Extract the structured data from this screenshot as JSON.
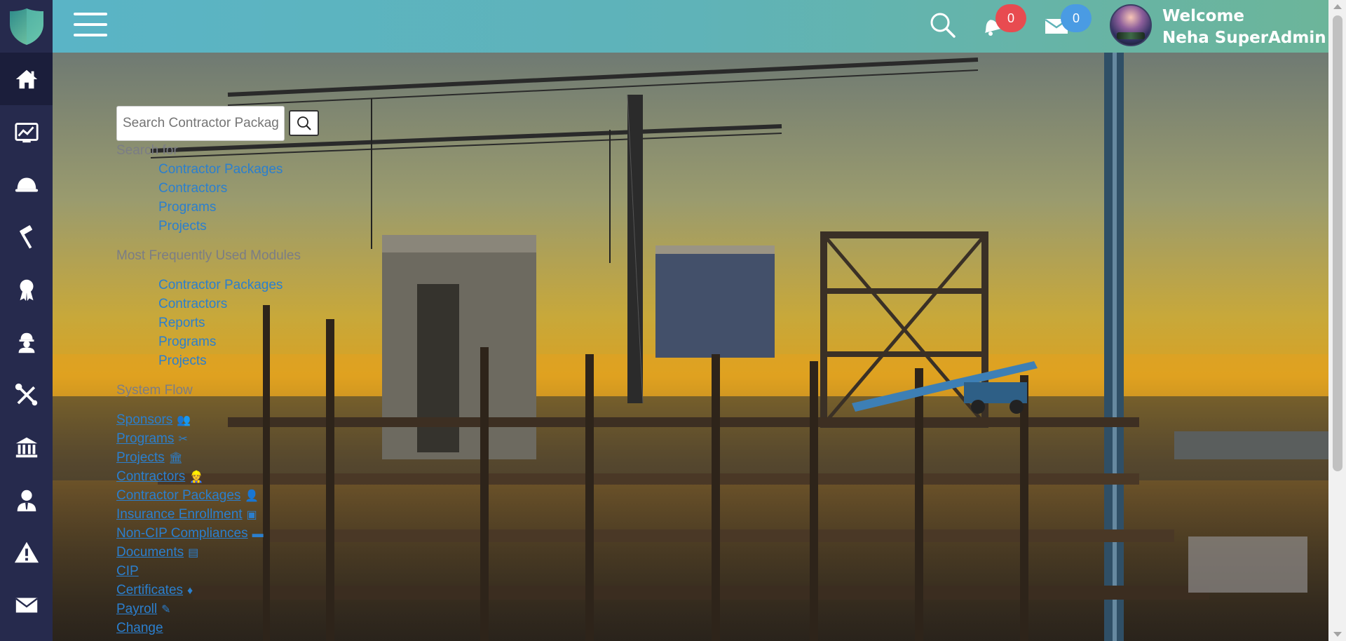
{
  "sidebar": {
    "logo_icon": "shield-logo",
    "items": [
      {
        "icon": "home-icon",
        "active": true
      },
      {
        "icon": "dashboard-chart-icon",
        "active": false
      },
      {
        "icon": "bell-icon",
        "active": false
      },
      {
        "icon": "hammer-icon",
        "active": false
      },
      {
        "icon": "award-ribbon-icon",
        "active": false
      },
      {
        "icon": "worker-icon",
        "active": false
      },
      {
        "icon": "tools-icon",
        "active": false
      },
      {
        "icon": "bank-icon",
        "active": false
      },
      {
        "icon": "user-tie-icon",
        "active": false
      },
      {
        "icon": "warning-icon",
        "active": false
      },
      {
        "icon": "envelope-icon",
        "active": false
      }
    ]
  },
  "header": {
    "notifications_count": "0",
    "messages_count": "0",
    "welcome_line1": "Welcome",
    "welcome_line2": "Neha SuperAdmin",
    "colors": {
      "notification_badge": "#e84b50",
      "message_badge": "#4a9be3"
    }
  },
  "search": {
    "placeholder": "Search Contractor Packages"
  },
  "search_for": {
    "title": "Search for",
    "items": [
      "Contractor Packages",
      "Contractors",
      "Programs",
      "Projects"
    ]
  },
  "frequent": {
    "title": "Most Frequently Used Modules",
    "items": [
      "Contractor Packages",
      "Contractors",
      "Reports",
      "Programs",
      "Projects"
    ]
  },
  "system_flow": {
    "title": "System Flow",
    "items": [
      {
        "label": "Sponsors",
        "icon": "👥"
      },
      {
        "label": "Programs",
        "icon": "✂"
      },
      {
        "label": "Projects",
        "icon": "🏛"
      },
      {
        "label": "Contractors",
        "icon": "👷"
      },
      {
        "label": "Contractor Packages",
        "icon": "👤"
      },
      {
        "label": "Insurance Enrollment",
        "icon": "▣"
      },
      {
        "label": "Non-CIP Compliances",
        "icon": "▬"
      },
      {
        "label": "Documents",
        "icon": "▤"
      },
      {
        "label": "CIP",
        "icon": ""
      },
      {
        "label": "Certificates",
        "icon": "♦"
      },
      {
        "label": "Payroll",
        "icon": "✎"
      },
      {
        "label": "Change",
        "icon": ""
      }
    ]
  }
}
